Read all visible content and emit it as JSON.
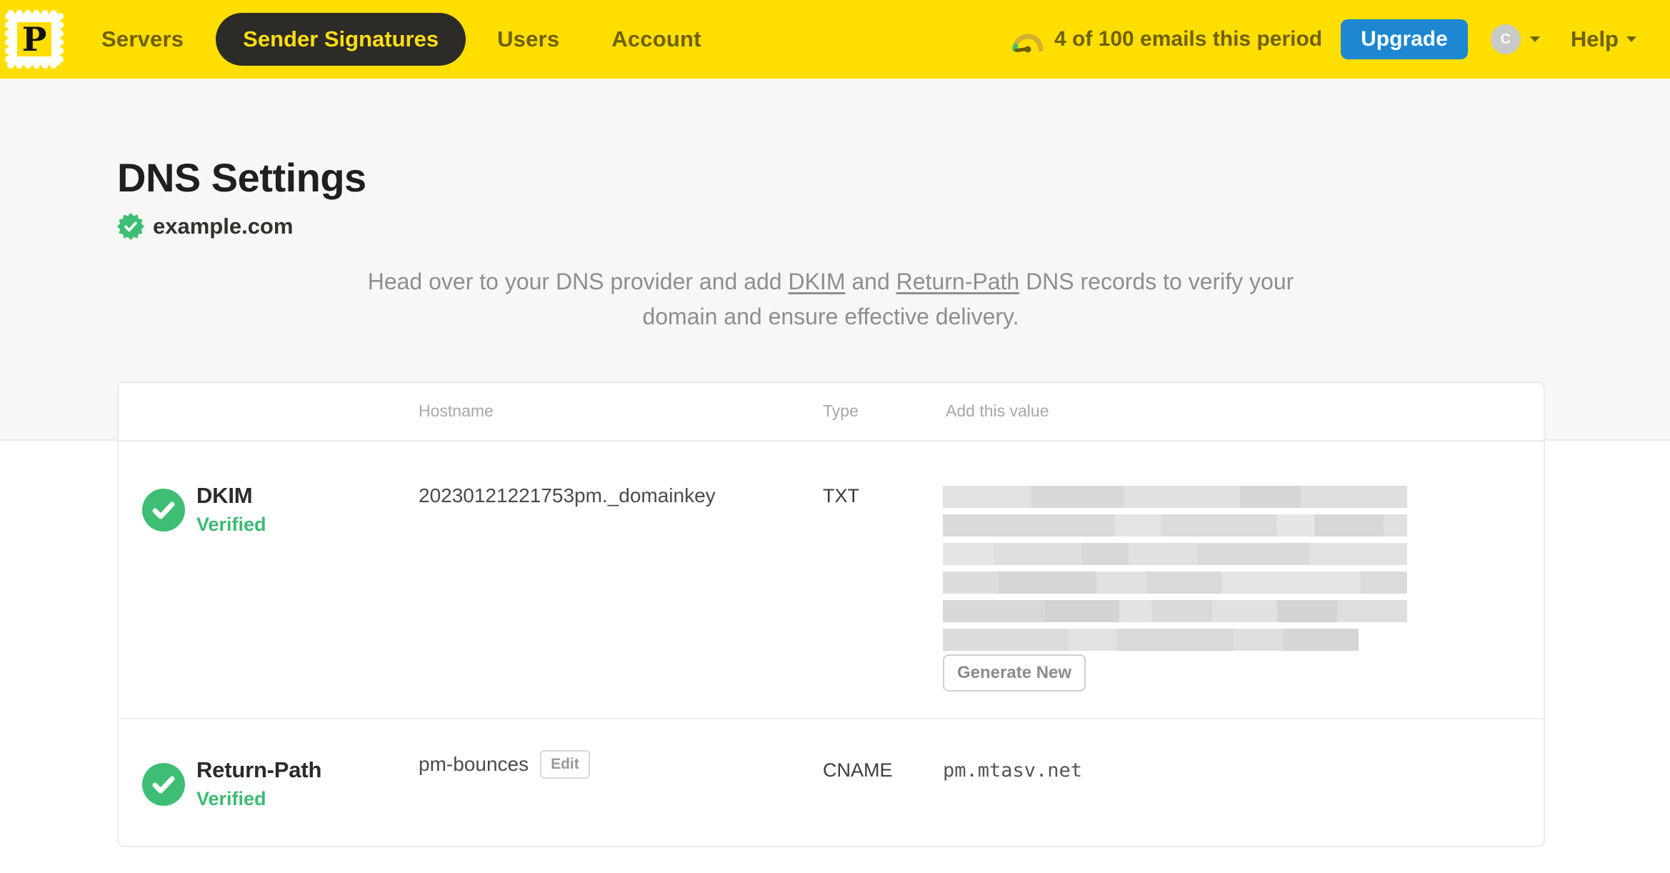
{
  "nav": {
    "brand_letter": "P",
    "items": [
      {
        "label": "Servers",
        "active": false
      },
      {
        "label": "Sender Signatures",
        "active": true
      },
      {
        "label": "Users",
        "active": false
      },
      {
        "label": "Account",
        "active": false
      }
    ],
    "usage_text": "4 of 100 emails this period",
    "upgrade_label": "Upgrade",
    "avatar_initial": "C",
    "help_label": "Help"
  },
  "page": {
    "title": "DNS Settings",
    "domain": "example.com",
    "domain_verified": true,
    "description": {
      "part1": "Head over to your DNS provider and add ",
      "link1": "DKIM",
      "part2": " and ",
      "link2": "Return-Path",
      "part3": " DNS records to verify your domain and ensure effective delivery."
    }
  },
  "table": {
    "headers": {
      "hostname": "Hostname",
      "type": "Type",
      "value": "Add this value"
    },
    "rows": [
      {
        "name": "DKIM",
        "status": "Verified",
        "hostname": "20230121221753pm._domainkey",
        "type": "TXT",
        "value_redacted": true,
        "action_label": "Generate New"
      },
      {
        "name": "Return-Path",
        "status": "Verified",
        "hostname": "pm-bounces",
        "edit_label": "Edit",
        "type": "CNAME",
        "value": "pm.mtasv.net"
      }
    ]
  },
  "colors": {
    "brand_yellow": "#ffde00",
    "nav_text_olive": "#6f6105",
    "active_pill_bg": "#2d2b27",
    "upgrade_blue": "#1d87d2",
    "success_green": "#3ebe74",
    "muted_gray": "#8e8e8e"
  }
}
